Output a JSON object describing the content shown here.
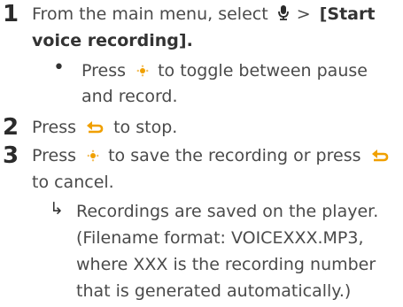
{
  "top_fragment": "partially visible text",
  "steps": [
    {
      "number": "1",
      "line1_prefix": "From the main menu, select",
      "line1_gt": ">",
      "line1_bracket": "[Start",
      "line2_bracket": "voice recording].",
      "sub_bullet_1": "Press",
      "sub_bullet_1_tail": "to toggle between pause",
      "sub_bullet_2": "and record."
    },
    {
      "number": "2",
      "line1_prefix": "Press",
      "line1_suffix": "to stop."
    },
    {
      "number": "3",
      "line1_prefix": "Press",
      "line1_mid": "to save the recording or press",
      "line2": "to cancel.",
      "result_1": "Recordings are saved on the player.",
      "result_2": "(Filename format: VOICEXXX.MP3,",
      "result_3": "where XXX is the recording number",
      "result_4": "that is generated automatically.)"
    }
  ],
  "icons": {
    "mic": "microphone-icon",
    "play": "play-pause-icon",
    "back": "back-icon"
  },
  "colors": {
    "accent": "#f0a000",
    "text": "#4a4a4a"
  }
}
